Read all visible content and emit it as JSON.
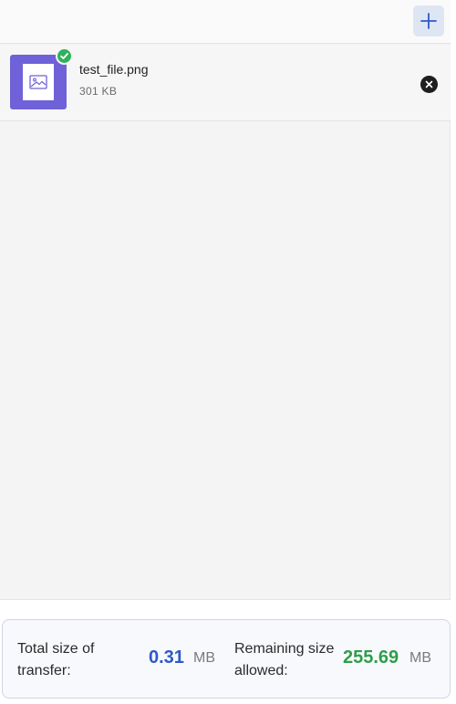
{
  "toolbar": {
    "add_icon": "plus-icon",
    "add_color": "#2f58c9"
  },
  "files": [
    {
      "name": "test_file.png",
      "size": "301 KB",
      "status": "uploaded",
      "thumbnail_icon": "image-icon",
      "thumbnail_color": "#6f62d8",
      "status_color": "#2fb15b",
      "remove_icon": "close-icon"
    }
  ],
  "summary": {
    "total_label": "Total size of transfer:",
    "total_value": "0.31",
    "total_unit": "MB",
    "total_color": "#2f58c9",
    "remaining_label": "Remaining size allowed:",
    "remaining_value": "255.69",
    "remaining_unit": "MB",
    "remaining_color": "#2e9e4a"
  }
}
